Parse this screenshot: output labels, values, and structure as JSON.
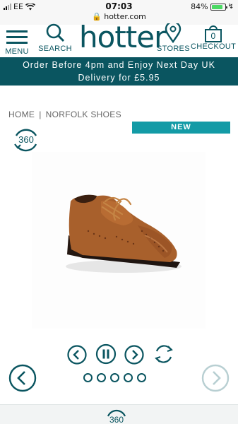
{
  "status_bar": {
    "carrier": "EE",
    "time": "07:03",
    "url": "hotter.com",
    "battery": "84%",
    "battery_level": 0.84
  },
  "header": {
    "menu_label": "MENU",
    "search_label": "SEARCH",
    "logo": "hotter",
    "stores_label": "STORES",
    "checkout_label": "CHECKOUT",
    "cart_count": "0"
  },
  "promo": {
    "line1": "Order Before 4pm and Enjoy Next Day UK",
    "line2": "Delivery for £5.95"
  },
  "breadcrumb": {
    "home": "HOME",
    "separator": "|",
    "current": "NORFOLK SHOES"
  },
  "product": {
    "badge": "NEW",
    "view360_label": "360",
    "footer_360_label": "360",
    "image_icon": "tan-brogue-shoe"
  },
  "carousel": {
    "dot_count": 5,
    "icons": [
      "prev-icon",
      "pause-icon",
      "next-icon",
      "replay-icon"
    ]
  },
  "colors": {
    "brand": "#0a5560",
    "accent": "#139ba6",
    "shoe": "#a8602c"
  }
}
